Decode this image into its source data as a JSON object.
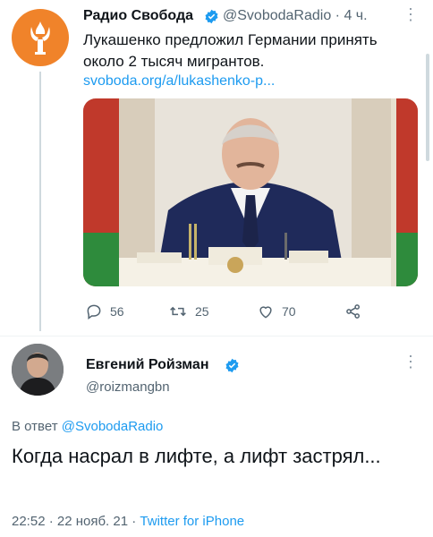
{
  "tweet1": {
    "author_name": "Радио Свобода",
    "handle": "@SvobodaRadio",
    "time": "· 4 ч.",
    "text": "Лукашенко предложил Германии принять около 2 тысяч мигрантов.",
    "link": "svoboda.org/a/lukashenko-p...",
    "replies": "56",
    "retweets": "25",
    "likes": "70",
    "avatar_color": "#f0832a"
  },
  "tweet2": {
    "author_name": "Евгений Ройзман",
    "handle": "@roizmangbn",
    "reply_prefix": "В ответ",
    "reply_handle": "@SvobodaRadio",
    "text": "Когда насрал в лифте, а лифт застрял...",
    "timestamp": "22:52 · 22 нояб. 21 ·",
    "source": "Twitter for iPhone"
  },
  "colors": {
    "link": "#1d9bf0",
    "verified": "#1d9bf0",
    "muted": "#536471"
  },
  "icons": [
    "verified-badge-icon",
    "more-dots-icon",
    "reply-icon",
    "retweet-icon",
    "like-icon",
    "share-icon",
    "radio-svoboda-logo"
  ]
}
